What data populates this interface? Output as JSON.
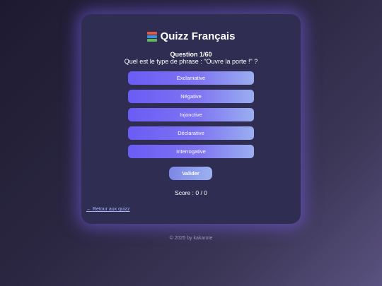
{
  "quiz": {
    "title": "Quizz Français",
    "title_icon": "books-icon",
    "question_number": "Question 1/60",
    "question_text": "Quel est le type de phrase : \"Ouvre la porte !\" ?",
    "options": [
      "Exclamative",
      "Négative",
      "Injonctive",
      "Déclarative",
      "Interrogative"
    ],
    "validate_label": "Valider",
    "score_text": "Score : 0 / 0",
    "back_link": "← Retour aux quizz"
  },
  "footer": {
    "text": "© 2025 by kakarote"
  },
  "colors": {
    "accent": "#6a5cf5",
    "accent_end": "#9aaef0",
    "card_bg": "#2f2d52",
    "glow": "#785feb",
    "link": "#a9b4f7"
  }
}
